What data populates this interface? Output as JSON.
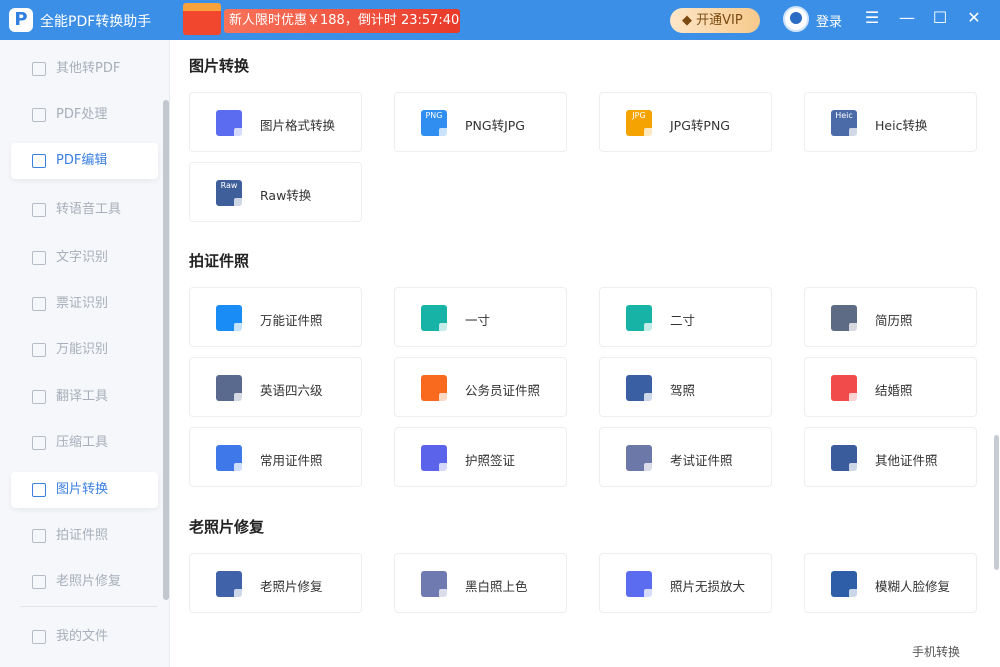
{
  "app": {
    "title": "全能PDF转换助手",
    "promo": "新人限时优惠￥188，倒计时 23:57:40",
    "vip_label": "开通VIP",
    "login_label": "登录"
  },
  "sidebar": {
    "items": [
      {
        "label": "其他转PDF"
      },
      {
        "label": "PDF处理"
      },
      {
        "label": "PDF编辑",
        "state": "hover"
      },
      {
        "label": "转语音工具"
      },
      {
        "label": "文字识别"
      },
      {
        "label": "票证识别"
      },
      {
        "label": "万能识别"
      },
      {
        "label": "翻译工具"
      },
      {
        "label": "压缩工具"
      },
      {
        "label": "图片转换",
        "state": "active"
      },
      {
        "label": "拍证件照"
      },
      {
        "label": "老照片修复"
      }
    ],
    "my_files": "我的文件"
  },
  "sections": [
    {
      "title": "图片转换",
      "cards": [
        {
          "label": "图片格式转换",
          "color": "#5b6cf0",
          "badge": ""
        },
        {
          "label": "PNG转JPG",
          "color": "#2f8ef0",
          "badge": "PNG"
        },
        {
          "label": "JPG转PNG",
          "color": "#f5a300",
          "badge": "JPG"
        },
        {
          "label": "Heic转换",
          "color": "#4a6aa8",
          "badge": "Heic"
        },
        {
          "label": "Raw转换",
          "color": "#3e5f9a",
          "badge": "Raw"
        }
      ]
    },
    {
      "title": "拍证件照",
      "cards": [
        {
          "label": "万能证件照",
          "color": "#1a8cf5",
          "badge": ""
        },
        {
          "label": "一寸",
          "color": "#16b3a6",
          "badge": ""
        },
        {
          "label": "二寸",
          "color": "#16b3a6",
          "badge": ""
        },
        {
          "label": "简历照",
          "color": "#5d6b85",
          "badge": ""
        },
        {
          "label": "英语四六级",
          "color": "#5a6a8f",
          "badge": ""
        },
        {
          "label": "公务员证件照",
          "color": "#fa6a1e",
          "badge": ""
        },
        {
          "label": "驾照",
          "color": "#3a5fa3",
          "badge": ""
        },
        {
          "label": "结婚照",
          "color": "#f24b4b",
          "badge": ""
        },
        {
          "label": "常用证件照",
          "color": "#3f78e8",
          "badge": ""
        },
        {
          "label": "护照签证",
          "color": "#5b63ea",
          "badge": ""
        },
        {
          "label": "考试证件照",
          "color": "#6b78a8",
          "badge": ""
        },
        {
          "label": "其他证件照",
          "color": "#3a5c9c",
          "badge": ""
        }
      ]
    },
    {
      "title": "老照片修复",
      "cards": [
        {
          "label": "老照片修复",
          "color": "#3f62a8",
          "badge": ""
        },
        {
          "label": "黑白照上色",
          "color": "#6f7ab0",
          "badge": ""
        },
        {
          "label": "照片无损放大",
          "color": "#5b6cf0",
          "badge": ""
        },
        {
          "label": "模糊人脸修复",
          "color": "#2f5ea8",
          "badge": ""
        }
      ]
    }
  ],
  "footer": {
    "mobile_convert": "手机转换"
  }
}
